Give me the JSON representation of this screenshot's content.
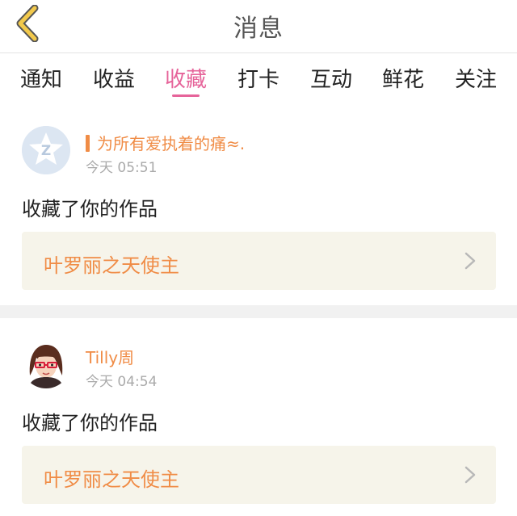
{
  "header": {
    "title": "消息",
    "back_icon": "chevron-left-icon",
    "back_icon_color": "#f2c94c"
  },
  "tabs": [
    {
      "label": "通知",
      "active": false
    },
    {
      "label": "收益",
      "active": false
    },
    {
      "label": "收藏",
      "active": true
    },
    {
      "label": "打卡",
      "active": false
    },
    {
      "label": "互动",
      "active": false
    },
    {
      "label": "鲜花",
      "active": false
    },
    {
      "label": "关注",
      "active": false
    }
  ],
  "colors": {
    "accent_pink": "#e6649a",
    "orange": "#f08c46",
    "muted": "#aaaaaa"
  },
  "notifications": [
    {
      "username": "为所有爱执着的痛≈.",
      "time": "今天 05:51",
      "action": "收藏了你的作品",
      "work_title": "叶罗丽之天使主",
      "avatar": "default-qzone-avatar"
    },
    {
      "username": "Tilly周",
      "time": "今天 04:54",
      "action": "收藏了你的作品",
      "work_title": "叶罗丽之天使主",
      "avatar": "girl-with-glasses-avatar"
    }
  ]
}
